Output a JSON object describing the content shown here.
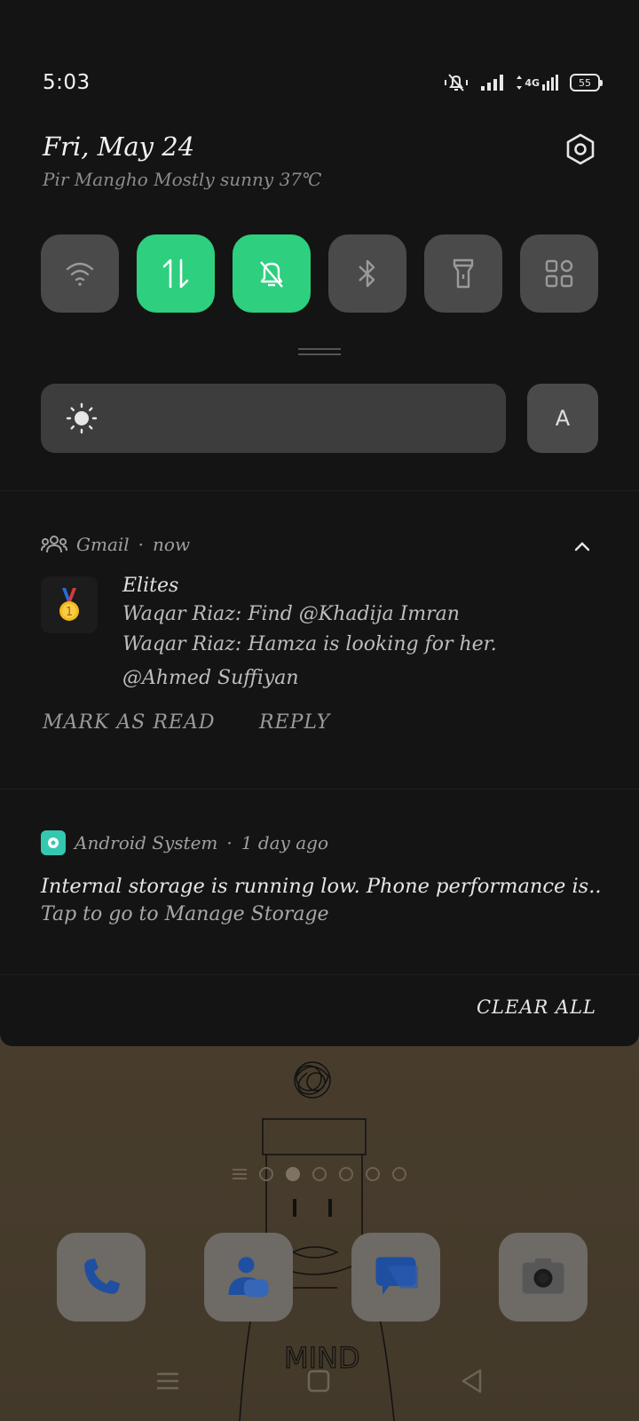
{
  "status": {
    "time": "5:03",
    "network": "4G",
    "battery": "55"
  },
  "header": {
    "date": "Fri, May 24",
    "weather": "Pir Mangho Mostly sunny 37℃"
  },
  "quick_tiles": [
    {
      "icon": "wifi-icon",
      "on": false
    },
    {
      "icon": "mobile-data-icon",
      "on": true
    },
    {
      "icon": "mute-bell-icon",
      "on": true
    },
    {
      "icon": "bluetooth-icon",
      "on": false
    },
    {
      "icon": "flashlight-icon",
      "on": false
    },
    {
      "icon": "grid-apps-icon",
      "on": false
    }
  ],
  "brightness": {
    "auto_label": "A"
  },
  "gmail_notification": {
    "app": "Gmail",
    "time": "now",
    "title": "Elites",
    "lines": [
      "Waqar Riaz: Find @Khadija Imran",
      "Waqar Riaz: Hamza is looking for her.",
      "@Ahmed Suffiyan"
    ],
    "actions": {
      "mark_read": "MARK AS READ",
      "reply": "REPLY"
    }
  },
  "system_notification": {
    "app": "Android System",
    "time": "1 day ago",
    "text": "Internal storage is running low. Phone performance is..",
    "subtext": "Tap to go to Manage Storage"
  },
  "clear_all": "CLEAR ALL",
  "home": {
    "dock_apps": [
      "phone-icon",
      "contacts-icon",
      "messages-icon",
      "camera-icon"
    ],
    "wallpaper_text": "MIND"
  },
  "colors": {
    "shade": "#141414",
    "tile_on": "#2ecf7e",
    "tile_off": "#4a4a4a"
  }
}
